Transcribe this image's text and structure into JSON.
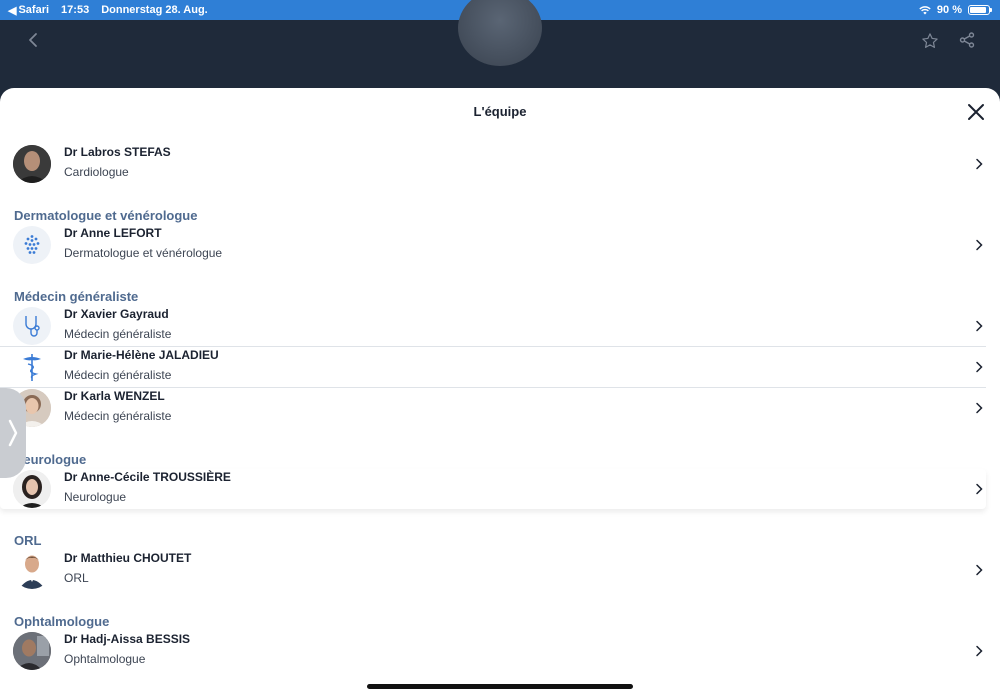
{
  "status_bar": {
    "back_app": "Safari",
    "time": "17:53",
    "date": "Donnerstag 28. Aug.",
    "battery_text": "90 %",
    "battery_level": 0.9
  },
  "sheet": {
    "title": "L'équipe"
  },
  "team": {
    "top": {
      "name": "Dr Labros STEFAS",
      "specialty": "Cardiologue",
      "avatar_icon": "person-photo"
    },
    "sections": [
      {
        "title": "Dermatologue et vénérologue",
        "members": [
          {
            "name": "Dr Anne LEFORT",
            "specialty": "Dermatologue et vénérologue",
            "avatar_icon": "dots-placeholder-icon"
          }
        ]
      },
      {
        "title": "Médecin généraliste",
        "members": [
          {
            "name": "Dr Xavier Gayraud",
            "specialty": "Médecin généraliste",
            "avatar_icon": "stethoscope-icon"
          },
          {
            "name": "Dr Marie-Hélène JALADIEU",
            "specialty": "Médecin généraliste",
            "avatar_icon": "caduceus-icon"
          },
          {
            "name": "Dr Karla WENZEL",
            "specialty": "Médecin généraliste",
            "avatar_icon": "person-photo"
          }
        ]
      },
      {
        "title": "Neurologue",
        "members": [
          {
            "name": "Dr Anne-Cécile TROUSSIÈRE",
            "specialty": "Neurologue",
            "avatar_icon": "person-photo"
          }
        ]
      },
      {
        "title": "ORL",
        "members": [
          {
            "name": "Dr Matthieu CHOUTET",
            "specialty": "ORL",
            "avatar_icon": "person-photo"
          }
        ]
      },
      {
        "title": "Ophtalmologue",
        "members": [
          {
            "name": "Dr Hadj-Aissa BESSIS",
            "specialty": "Ophtalmologue",
            "avatar_icon": "person-photo"
          }
        ]
      }
    ]
  },
  "colors": {
    "status_bar": "#2f7fd6",
    "backdrop": "#1f2a3a",
    "section_title": "#4f6a8f",
    "text": "#1b2230",
    "icon_blue": "#3a7bd5"
  }
}
